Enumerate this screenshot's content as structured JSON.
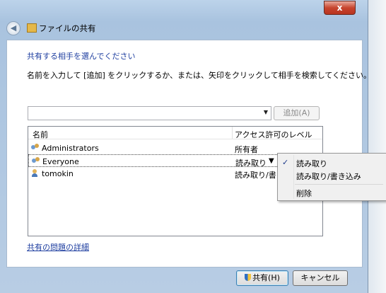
{
  "window": {
    "title": "ファイルの共有",
    "close_label": "x"
  },
  "page": {
    "heading": "共有する相手を選んでください",
    "description": "名前を入力して [追加] をクリックするか、または、矢印をクリックして相手を検索してください。"
  },
  "input": {
    "value": "",
    "add_button": "追加(A)"
  },
  "list": {
    "columns": [
      "名前",
      "アクセス許可のレベル"
    ],
    "rows": [
      {
        "name": "Administrators",
        "permission": "所有者",
        "icon": "group-icon"
      },
      {
        "name": "Everyone",
        "permission": "読み取り",
        "icon": "group-icon"
      },
      {
        "name": "tomokin",
        "permission": "読み取り/書き",
        "icon": "user-icon"
      }
    ]
  },
  "menu": {
    "items": [
      "読み取り",
      "読み取り/書き込み",
      "削除"
    ],
    "checked_index": 0,
    "check_mark": "✓"
  },
  "link": "共有の問題の詳細",
  "buttons": {
    "share": "共有(H)",
    "cancel": "キャンセル"
  }
}
